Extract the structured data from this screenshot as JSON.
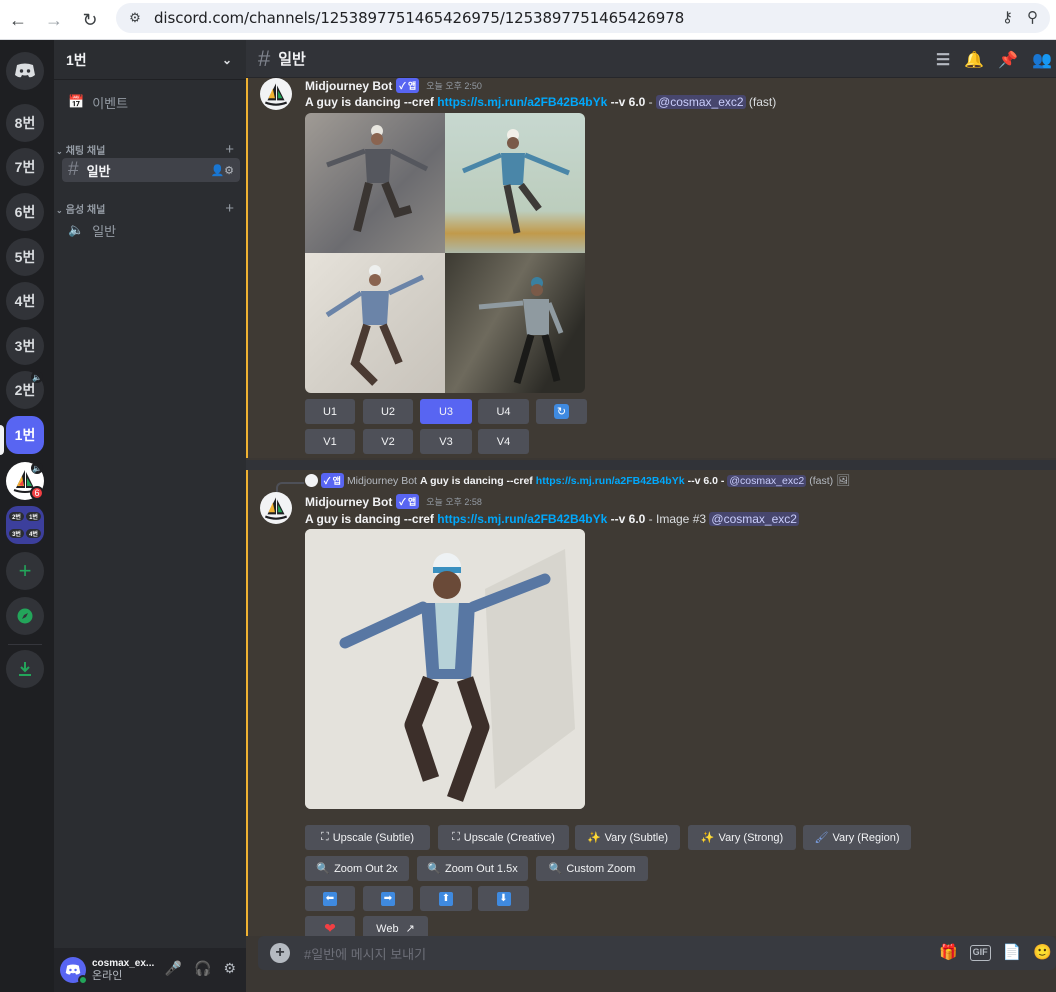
{
  "browser": {
    "url": "discord.com/channels/1253897751465426975/1253897751465426978"
  },
  "servers": {
    "items": [
      "8번",
      "7번",
      "6번",
      "5번",
      "4번",
      "3번",
      "2번",
      "1번"
    ],
    "folder_labels": [
      "2번",
      "1번",
      "3번",
      "4번"
    ],
    "badge_count": "6"
  },
  "guild": {
    "name": "1번"
  },
  "sidebar": {
    "events_label": "이벤트",
    "text_category": "채팅 채널",
    "text_channel": "일반",
    "voice_category": "음성 채널",
    "voice_channel": "일반"
  },
  "user": {
    "name": "cosmax_ex...",
    "status": "온라인"
  },
  "channel": {
    "name": "일반"
  },
  "message1": {
    "author": "Midjourney Bot",
    "app_tag": "앱",
    "time": "오늘 오후 2:50",
    "prompt": "A guy is dancing --cref",
    "link": "https://s.mj.run/a2FB42B4bYk",
    "version": "--v 6.0",
    "dash": "-",
    "mention": "@cosmax_exc2",
    "suffix": "(fast)",
    "buttons_u": [
      "U1",
      "U2",
      "U3",
      "U4"
    ],
    "buttons_v": [
      "V1",
      "V2",
      "V3",
      "V4"
    ]
  },
  "message2": {
    "reply_author": "Midjourney Bot",
    "reply_app_tag": "앱",
    "reply_prompt": "A guy is dancing --cref",
    "reply_link": "https://s.mj.run/a2FB42B4bYk",
    "reply_version": "--v 6.0 -",
    "reply_mention": "@cosmax_exc2",
    "reply_suffix": "(fast)",
    "author": "Midjourney Bot",
    "app_tag": "앱",
    "time": "오늘 오후 2:58",
    "prompt": "A guy is dancing --cref",
    "link": "https://s.mj.run/a2FB42B4bYk",
    "version": "--v 6.0",
    "image_label": "- Image #3",
    "mention": "@cosmax_exc2",
    "buttons_row1": [
      "Upscale (Subtle)",
      "Upscale (Creative)",
      "Vary (Subtle)",
      "Vary (Strong)",
      "Vary (Region)"
    ],
    "buttons_row2": [
      "Zoom Out 2x",
      "Zoom Out 1.5x",
      "Custom Zoom"
    ],
    "web_label": "Web"
  },
  "composer": {
    "placeholder": "#일반에 메시지 보내기",
    "gif_label": "GIF"
  },
  "colors": {
    "accent": "#5865f2",
    "link": "#00a8fc",
    "highlight_border": "#f0b232"
  }
}
